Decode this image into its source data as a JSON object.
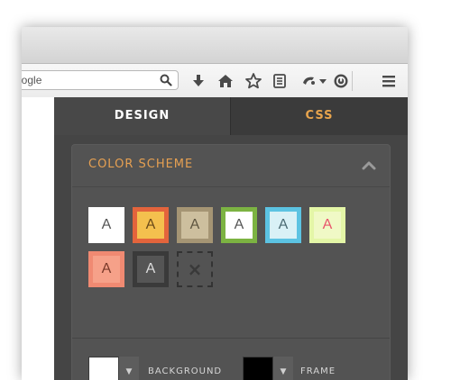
{
  "browser": {
    "search": {
      "value": "oogle",
      "placeholder": ""
    },
    "toolbar_icons": [
      "search-icon",
      "download-icon",
      "home-icon",
      "bookmark-star-icon",
      "reading-list-icon",
      "extension-icon",
      "chevron-down-icon",
      "history-icon",
      "hamburger-menu-icon"
    ]
  },
  "tabs": [
    {
      "label": "DESIGN",
      "active": true
    },
    {
      "label": "CSS",
      "active": false
    }
  ],
  "color_scheme": {
    "title": "COLOR SCHEME",
    "swatches": [
      {
        "letter": "A",
        "bg": "#ffffff",
        "border": "#ffffff",
        "fg": "#555555"
      },
      {
        "letter": "A",
        "bg": "#f4c04e",
        "border": "#e3643c",
        "fg": "#6a4a1a"
      },
      {
        "letter": "A",
        "bg": "#cdbf9e",
        "border": "#a59574",
        "fg": "#5e5540"
      },
      {
        "letter": "A",
        "bg": "#ffffff",
        "border": "#7cb342",
        "fg": "#555555"
      },
      {
        "letter": "A",
        "bg": "#d9f1f6",
        "border": "#5cc3e2",
        "fg": "#4a6a72"
      },
      {
        "letter": "A",
        "bg": "#f0f9c6",
        "border": "#e4f6a7",
        "fg": "#e9546c"
      },
      {
        "letter": "A",
        "bg": "#f6a189",
        "border": "#f08a72",
        "fg": "#7a3a2a"
      },
      {
        "letter": "A",
        "bg": "#555555",
        "border": "#3a3a3a",
        "fg": "#dddddd"
      }
    ],
    "clear_symbol": "×"
  },
  "pickers": {
    "background": {
      "label": "BACKGROUND",
      "color": "#ffffff",
      "arrow": "▼"
    },
    "frame": {
      "label": "FRAME",
      "color": "#000000",
      "arrow": "▼"
    }
  },
  "accent_color": "#e6a052"
}
